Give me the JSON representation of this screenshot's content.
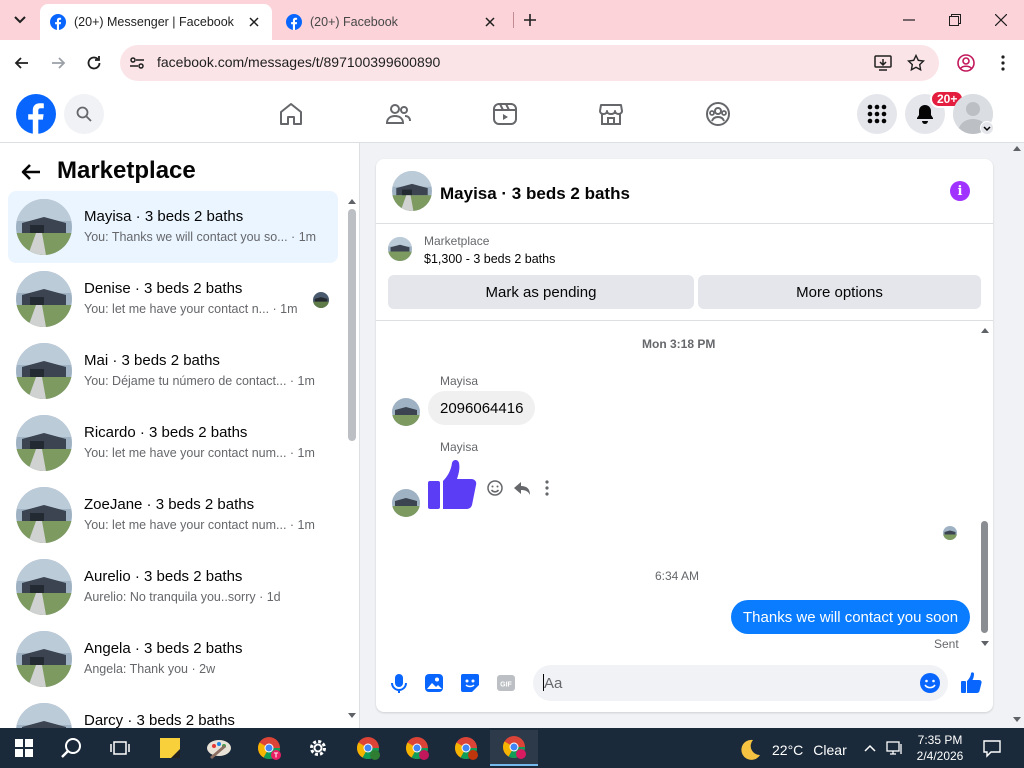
{
  "browser": {
    "tabs": [
      {
        "title": "(20+) Messenger | Facebook",
        "active": true
      },
      {
        "title": "(20+) Facebook",
        "active": false
      }
    ],
    "url": "facebook.com/messages/t/897100399600890"
  },
  "fb": {
    "notifications_badge": "20+",
    "brand_color": "#0866ff"
  },
  "sidebar": {
    "title": "Marketplace",
    "conversations": [
      {
        "name": "Mayisa · 3 beds 2 baths",
        "preview": "You: Thanks we will contact you so... · 1m",
        "selected": true
      },
      {
        "name": "Denise · 3 beds 2 baths",
        "preview": "You: let me have your contact n... · 1m"
      },
      {
        "name": "Mai · 3 beds 2 baths",
        "preview": "You: Déjame tu número de contact... · 1m"
      },
      {
        "name": "Ricardo · 3 beds 2 baths",
        "preview": "You: let me have your contact num... · 1m"
      },
      {
        "name": "ZoeJane · 3 beds 2 baths",
        "preview": "You: let me have your contact num... · 1m"
      },
      {
        "name": "Aurelio · 3 beds 2 baths",
        "preview": "Aurelio: No tranquila you..sorry · 1d"
      },
      {
        "name": "Angela · 3 beds 2 baths",
        "preview": "Angela: Thank you · 2w"
      },
      {
        "name": "Darcy · 3 beds 2 baths",
        "preview": ""
      }
    ]
  },
  "chat": {
    "title": "Mayisa · 3 beds 2 baths",
    "listing": {
      "label": "Marketplace",
      "summary": "$1,300 - 3 beds 2 baths"
    },
    "buttons": {
      "mark_pending": "Mark as pending",
      "more_options": "More options"
    },
    "messages": {
      "timestamp1": "Mon 3:18 PM",
      "sender1": "Mayisa",
      "text1": "2096064416",
      "sender2": "Mayisa",
      "timestamp2": "6:34 AM",
      "outgoing": "Thanks we will contact you soon",
      "status": "Sent"
    },
    "composer_placeholder": "Aa"
  },
  "taskbar": {
    "weather_temp": "22°C",
    "weather_desc": "Clear",
    "time": "7:35 PM",
    "date": "2/4/2026"
  }
}
